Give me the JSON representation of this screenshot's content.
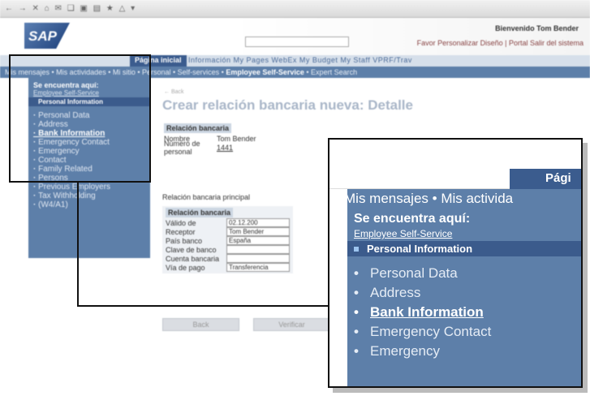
{
  "toolbar": {
    "glyphs": "← → ✕ ⌂ ✉ ❑ ▣ ▤ ★ △ ▾"
  },
  "header": {
    "logo": "SAP",
    "welcome": "Bienvenido Tom Bender",
    "links": "Favor  Personalizar  Diseño | Portal  Salir del sistema"
  },
  "nav_top": {
    "active": "Página inicial",
    "items": "Información   My Pages   WebEx   My Budget   My Staff   VPRF/Trav"
  },
  "nav_sub": {
    "prefix": "Mis mensajes  •  Mis actividades  •  Mi sitio  •  Personal  •  Self-services  • ",
    "current": "Employee Self-Service",
    "suffix": " •  Expert Search"
  },
  "sidebar": {
    "heading": "Se encuentra aquí:",
    "link": "Employee Self-Service",
    "current": "Personal Information",
    "items": [
      "Personal Data",
      "Address",
      "Bank Information",
      "Emergency Contact",
      "Emergency",
      "Contact",
      "Family Related",
      "Persons",
      "Previous Employers",
      "Tax Withholding",
      "(W4/A1)"
    ]
  },
  "main": {
    "crumb": "← Back",
    "title": "Crear relación bancaria nueva: Detalle",
    "section1": "Relación bancaria",
    "fields1": [
      {
        "k": "Nombre",
        "v": "Tom Bender"
      },
      {
        "k": "Número de personal",
        "v": "1441"
      }
    ],
    "section2_caption": "Relación bancaria principal",
    "section2": "Relación bancaria",
    "fields2": [
      {
        "k": "Válido de",
        "v": "02.12.200"
      },
      {
        "k": "Receptor",
        "v": "Tom Bender"
      },
      {
        "k": "País banco",
        "v": "España"
      },
      {
        "k": "Clave de banco",
        "v": ""
      },
      {
        "k": "Cuenta bancaria",
        "v": ""
      },
      {
        "k": "Vía de pago",
        "v": "Transferencia"
      }
    ],
    "back_btn": "Back",
    "next_btn": "Verificar"
  },
  "zoom": {
    "tab_label": "Pági",
    "nav": "Mis mensajes  •  Mis activida",
    "heading": "Se encuentra aquí:",
    "link": "Employee Self-Service",
    "current": "Personal Information",
    "items": [
      "Personal Data",
      "Address",
      "Bank Information",
      "Emergency Contact",
      "Emergency"
    ]
  }
}
